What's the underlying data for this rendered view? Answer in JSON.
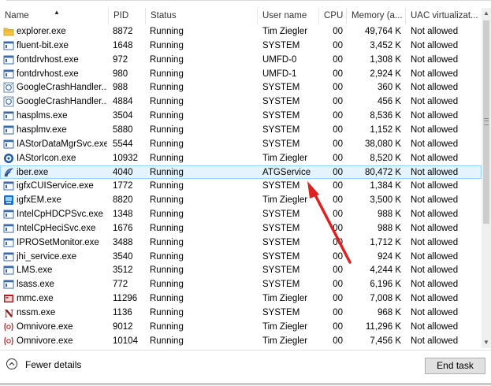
{
  "columns": {
    "name": "Name",
    "pid": "PID",
    "status": "Status",
    "user": "User name",
    "cpu": "CPU",
    "memory": "Memory (a...",
    "uac": "UAC virtualizat..."
  },
  "rows": [
    {
      "icon": "folder-icon",
      "name": "explorer.exe",
      "pid": "8872",
      "status": "Running",
      "user": "Tim Ziegler",
      "cpu": "00",
      "memory": "49,764 K",
      "uac": "Not allowed"
    },
    {
      "icon": "app-window-icon",
      "name": "fluent-bit.exe",
      "pid": "1648",
      "status": "Running",
      "user": "SYSTEM",
      "cpu": "00",
      "memory": "3,452 K",
      "uac": "Not allowed"
    },
    {
      "icon": "app-window-icon",
      "name": "fontdrvhost.exe",
      "pid": "972",
      "status": "Running",
      "user": "UMFD-0",
      "cpu": "00",
      "memory": "1,308 K",
      "uac": "Not allowed"
    },
    {
      "icon": "app-window-icon",
      "name": "fontdrvhost.exe",
      "pid": "980",
      "status": "Running",
      "user": "UMFD-1",
      "cpu": "00",
      "memory": "2,924 K",
      "uac": "Not allowed"
    },
    {
      "icon": "google-crash-icon",
      "name": "GoogleCrashHandler...",
      "pid": "988",
      "status": "Running",
      "user": "SYSTEM",
      "cpu": "00",
      "memory": "360 K",
      "uac": "Not allowed"
    },
    {
      "icon": "google-crash-icon",
      "name": "GoogleCrashHandler...",
      "pid": "4884",
      "status": "Running",
      "user": "SYSTEM",
      "cpu": "00",
      "memory": "456 K",
      "uac": "Not allowed"
    },
    {
      "icon": "app-window-icon",
      "name": "hasplms.exe",
      "pid": "3504",
      "status": "Running",
      "user": "SYSTEM",
      "cpu": "00",
      "memory": "8,536 K",
      "uac": "Not allowed"
    },
    {
      "icon": "app-window-icon",
      "name": "hasplmv.exe",
      "pid": "5880",
      "status": "Running",
      "user": "SYSTEM",
      "cpu": "00",
      "memory": "1,152 K",
      "uac": "Not allowed"
    },
    {
      "icon": "app-window-icon",
      "name": "IAStorDataMgrSvc.exe",
      "pid": "5544",
      "status": "Running",
      "user": "SYSTEM",
      "cpu": "00",
      "memory": "38,080 K",
      "uac": "Not allowed"
    },
    {
      "icon": "intel-storage-icon",
      "name": "IAStorIcon.exe",
      "pid": "10932",
      "status": "Running",
      "user": "Tim Ziegler",
      "cpu": "00",
      "memory": "8,520 K",
      "uac": "Not allowed"
    },
    {
      "icon": "iber-icon",
      "name": "iber.exe",
      "pid": "4040",
      "status": "Running",
      "user": "ATGService",
      "cpu": "00",
      "memory": "80,472 K",
      "uac": "Not allowed",
      "selected": true
    },
    {
      "icon": "app-window-icon",
      "name": "igfxCUIService.exe",
      "pid": "1772",
      "status": "Running",
      "user": "SYSTEM",
      "cpu": "00",
      "memory": "1,384 K",
      "uac": "Not allowed"
    },
    {
      "icon": "intel-graphics-icon",
      "name": "igfxEM.exe",
      "pid": "8820",
      "status": "Running",
      "user": "Tim Ziegler",
      "cpu": "00",
      "memory": "3,500 K",
      "uac": "Not allowed"
    },
    {
      "icon": "app-window-icon",
      "name": "IntelCpHDCPSvc.exe",
      "pid": "1348",
      "status": "Running",
      "user": "SYSTEM",
      "cpu": "00",
      "memory": "988 K",
      "uac": "Not allowed"
    },
    {
      "icon": "app-window-icon",
      "name": "IntelCpHeciSvc.exe",
      "pid": "1676",
      "status": "Running",
      "user": "SYSTEM",
      "cpu": "00",
      "memory": "988 K",
      "uac": "Not allowed"
    },
    {
      "icon": "app-window-icon",
      "name": "IPROSetMonitor.exe",
      "pid": "3488",
      "status": "Running",
      "user": "SYSTEM",
      "cpu": "00",
      "memory": "1,712 K",
      "uac": "Not allowed"
    },
    {
      "icon": "app-window-icon",
      "name": "jhi_service.exe",
      "pid": "3540",
      "status": "Running",
      "user": "SYSTEM",
      "cpu": "00",
      "memory": "924 K",
      "uac": "Not allowed"
    },
    {
      "icon": "app-window-icon",
      "name": "LMS.exe",
      "pid": "3512",
      "status": "Running",
      "user": "SYSTEM",
      "cpu": "00",
      "memory": "4,244 K",
      "uac": "Not allowed"
    },
    {
      "icon": "app-window-icon",
      "name": "lsass.exe",
      "pid": "772",
      "status": "Running",
      "user": "SYSTEM",
      "cpu": "00",
      "memory": "6,196 K",
      "uac": "Not allowed"
    },
    {
      "icon": "mmc-icon",
      "name": "mmc.exe",
      "pid": "11296",
      "status": "Running",
      "user": "Tim Ziegler",
      "cpu": "00",
      "memory": "7,008 K",
      "uac": "Not allowed"
    },
    {
      "icon": "nssm-icon",
      "name": "nssm.exe",
      "pid": "1136",
      "status": "Running",
      "user": "SYSTEM",
      "cpu": "00",
      "memory": "968 K",
      "uac": "Not allowed"
    },
    {
      "icon": "omnivore-icon",
      "name": "Omnivore.exe",
      "pid": "9012",
      "status": "Running",
      "user": "Tim Ziegler",
      "cpu": "00",
      "memory": "11,296 K",
      "uac": "Not allowed"
    },
    {
      "icon": "omnivore-icon",
      "name": "Omnivore.exe",
      "pid": "10104",
      "status": "Running",
      "user": "Tim Ziegler",
      "cpu": "00",
      "memory": "7,456 K",
      "uac": "Not allowed"
    }
  ],
  "footer": {
    "fewer_details": "Fewer details",
    "end_task": "End task"
  },
  "colors": {
    "selection_bg": "#e5f3ff",
    "selection_border": "#99d1ff",
    "annotation_arrow": "#e02020"
  }
}
